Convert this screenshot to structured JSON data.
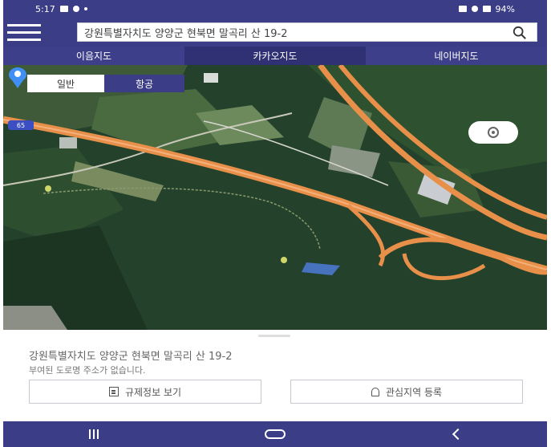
{
  "status_bar": {
    "time": "5:17",
    "battery": "94%"
  },
  "search": {
    "value": "강원특별자치도 양양군 현북면 말곡리 산 19-2",
    "placeholder": ""
  },
  "tabs": [
    {
      "label": "이음지도",
      "active": false
    },
    {
      "label": "카카오지도",
      "active": true
    },
    {
      "label": "네이버지도",
      "active": false
    }
  ],
  "map": {
    "type_toggle": {
      "normal": "일반",
      "sky": "항공"
    },
    "road_number": "65",
    "pin_color": "#3f8ff5",
    "road_color": "#e8904a"
  },
  "sheet": {
    "address": "강원특별자치도 양양군 현북면 말곡리 산 19-2",
    "note": "부여된 도로명 주소가 없습니다.",
    "btn_regulation": "규제정보 보기",
    "btn_favorite": "관심지역 등록"
  },
  "colors": {
    "brand": "#3b3d86"
  }
}
